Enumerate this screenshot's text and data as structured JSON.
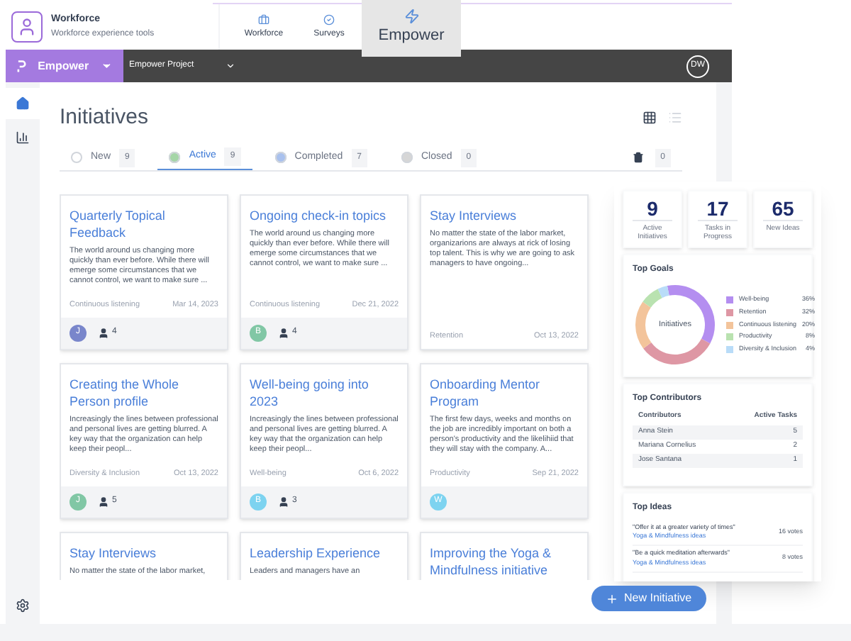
{
  "app_header": {
    "title": "Workforce",
    "subtitle": "Workforce experience tools"
  },
  "app_tabs": [
    {
      "label": "Workforce",
      "selected": false
    },
    {
      "label": "Surveys",
      "selected": false
    },
    {
      "label": "Empower",
      "selected": true
    }
  ],
  "nav_bar": {
    "product": "Empower",
    "project": "Empower Project",
    "user_initials": "DW"
  },
  "page_title": "Initiatives",
  "status_tabs": [
    {
      "label": "New",
      "count": "9",
      "selected": false,
      "color": "#ffffff"
    },
    {
      "label": "Active",
      "count": "9",
      "selected": true,
      "color": "#a5d6a7"
    },
    {
      "label": "Completed",
      "count": "7",
      "selected": false,
      "color": "#a9c1ee"
    },
    {
      "label": "Closed",
      "count": "0",
      "selected": false,
      "color": "#d6d6d6"
    }
  ],
  "trash_count": "0",
  "cards": [
    {
      "title": "Quarterly Topical Feedback",
      "description": "The world around us changing more quickly than ever before. While there will emerge some circumstances that we cannot control, we want to make sure ...",
      "category": "Continuous listening",
      "date": "Mar 14, 2023",
      "avatar": {
        "initial": "J",
        "color": "#7986cb"
      },
      "members": "4"
    },
    {
      "title": "Ongoing check-in topics",
      "description": "The world around us changing more quickly than ever before. While there will emerge some circumstances that we cannot control, we want to make sure ...",
      "category": "Continuous listening",
      "date": "Dec 21, 2022",
      "avatar": {
        "initial": "B",
        "color": "#81c7a5"
      },
      "members": "4"
    },
    {
      "title": "Stay Interviews",
      "description": "No matter the state of the labor market, organizarions are always at rick of losing top talent. This is why we are going to ask managers to have ongoing...",
      "category": "Retention",
      "date": "Oct 13, 2022"
    },
    {
      "title": "Creating the Whole Person profile",
      "description": "Increasingly the lines between professional and personal lives are getting blurred. A key way that the organization can help keep their peopl...",
      "category": "Diversity & Inclusion",
      "date": "Oct 13, 2022",
      "avatar": {
        "initial": "J",
        "color": "#81c7a5"
      },
      "members": "5"
    },
    {
      "title": "Well-being going into 2023",
      "description": "Increasingly the lines between professional and personal lives are getting blurred. A key way that the organization can help keep their peopl...",
      "category": "Well-being",
      "date": "Oct 6, 2022",
      "avatar": {
        "initial": "B",
        "color": "#7dd3f0"
      },
      "members": "3"
    },
    {
      "title": "Onboarding Mentor Program",
      "description": "The first few days, weeks and months on the job are incredibly important on both a person's productivity and the likelihiid that they will stay with the company. A...",
      "category": "Productivity",
      "date": "Sep 21, 2022",
      "avatar": {
        "initial": "W",
        "color": "#7dd3f0"
      }
    },
    {
      "title": "Stay Interviews",
      "description": "No matter the state of the labor market,"
    },
    {
      "title": "Leadership Experience",
      "description": "Leaders and managers have an"
    },
    {
      "title": "Improving the Yoga & Mindfulness initiative"
    }
  ],
  "summary": {
    "stats": [
      {
        "value": "9",
        "label": "Active Initiatives"
      },
      {
        "value": "17",
        "label": "Tasks in Progress"
      },
      {
        "value": "65",
        "label": "New Ideas"
      }
    ],
    "goals_title": "Top Goals",
    "chart_data": {
      "type": "donut",
      "title": "Initiatives",
      "categories": [
        "Well-being",
        "Retention",
        "Continuous listening",
        "Productivity",
        "Diversity & Inclusion"
      ],
      "values": [
        36,
        32,
        20,
        8,
        4
      ],
      "value_labels": [
        "36%",
        "32%",
        "20%",
        "8%",
        "4%"
      ],
      "colors": [
        "#b48ef0",
        "#de97a4",
        "#f3c49b",
        "#b9e2b0",
        "#b9dcf8"
      ]
    },
    "contributors_title": "Top Contributors",
    "contributor_columns": [
      "Contributors",
      "Active Tasks"
    ],
    "contributors": [
      {
        "name": "Anna Stein",
        "tasks": "5"
      },
      {
        "name": "Mariana Cornelius",
        "tasks": "2"
      },
      {
        "name": "Jose Santana",
        "tasks": "1"
      }
    ],
    "ideas_title": "Top Ideas",
    "ideas": [
      {
        "quote": "\"Offer it at a greater variety of times\"",
        "topic": "Yoga & Mindfulness ideas",
        "votes": "16 votes"
      },
      {
        "quote": "\"Be a quick meditation afterwards\"",
        "topic": "Yoga & Mindfulness ideas",
        "votes": "8 votes"
      }
    ]
  },
  "new_button": "New Initiative"
}
